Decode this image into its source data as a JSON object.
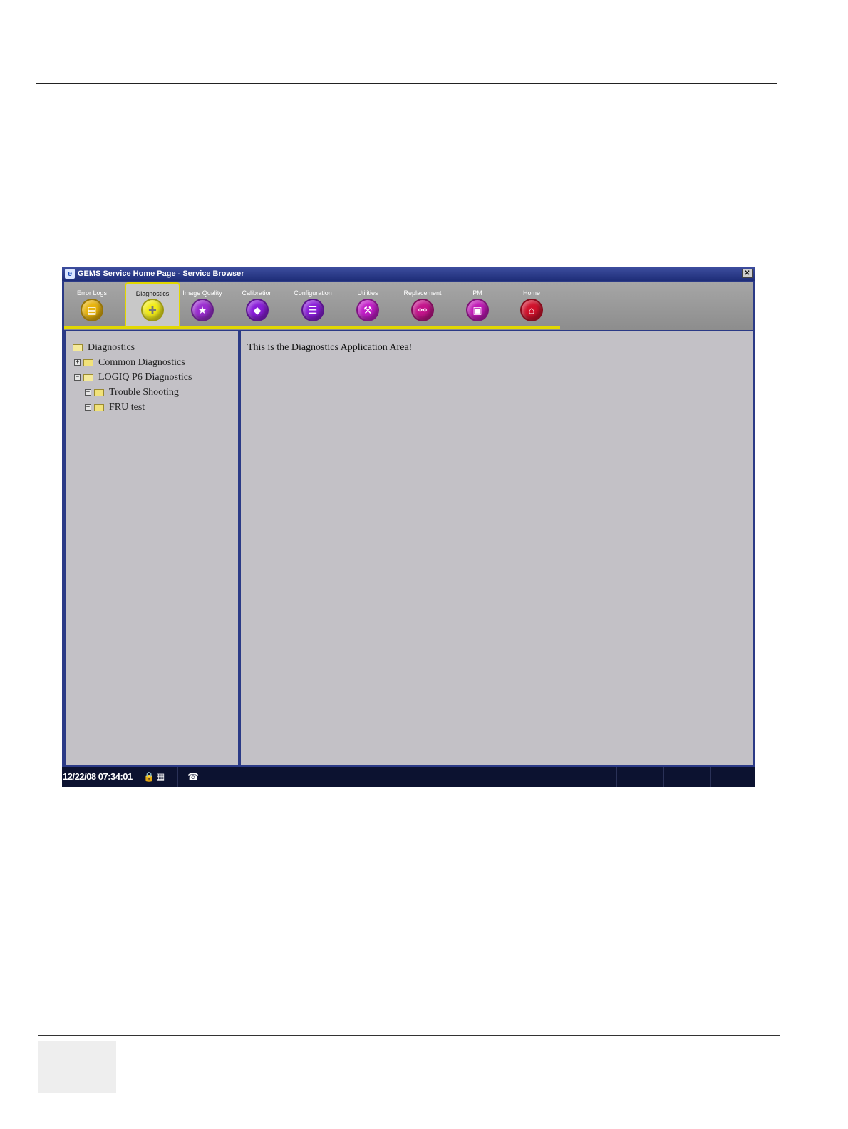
{
  "window": {
    "title": "GEMS Service Home Page - Service Browser",
    "close_glyph": "✕"
  },
  "toolbar": {
    "tabs": [
      {
        "label": "Error Logs",
        "icon": "error-logs-icon",
        "color": "#e8b30c",
        "glyph": "▤"
      },
      {
        "label": "Diagnostics",
        "icon": "diagnostics-icon",
        "color": "#f2ec1a",
        "glyph": "✚",
        "active": true
      },
      {
        "label": "Image Quality",
        "icon": "image-quality-icon",
        "color": "#9b2ed0",
        "glyph": "★"
      },
      {
        "label": "Calibration",
        "icon": "calibration-icon",
        "color": "#8a1ed9",
        "glyph": "◆"
      },
      {
        "label": "Configuration",
        "icon": "configuration-icon",
        "color": "#8a1ed9",
        "glyph": "☰"
      },
      {
        "label": "Utilities",
        "icon": "utilities-icon",
        "color": "#c21ec8",
        "glyph": "⚒"
      },
      {
        "label": "Replacement",
        "icon": "replacement-icon",
        "color": "#c4148c",
        "glyph": "⚯"
      },
      {
        "label": "PM",
        "icon": "pm-icon",
        "color": "#c01ab6",
        "glyph": "▣"
      },
      {
        "label": "Home",
        "icon": "home-icon",
        "color": "#d0122c",
        "glyph": "⌂"
      }
    ]
  },
  "tree": {
    "root": "Diagnostics",
    "items": [
      {
        "label": "Common Diagnostics",
        "expander": "+"
      },
      {
        "label": "LOGIQ P6 Diagnostics",
        "expander": "−"
      },
      {
        "label": "Trouble Shooting",
        "expander": "+"
      },
      {
        "label": "FRU test",
        "expander": "+"
      }
    ]
  },
  "main": {
    "text": "This is the Diagnostics Application Area!"
  },
  "statusbar": {
    "datetime": "12/22/08 07:34:01",
    "lock_glyph": "🔒",
    "network_glyph": "▦",
    "phone_glyph": "☎"
  }
}
